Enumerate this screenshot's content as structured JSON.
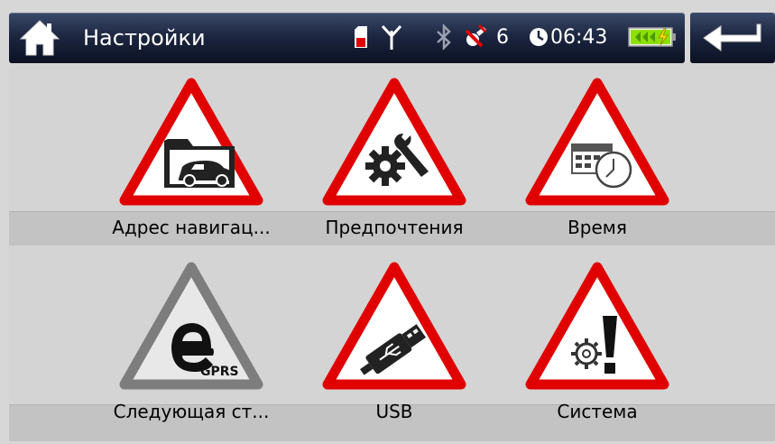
{
  "header": {
    "title": "Настройки",
    "satellites": "6",
    "time": "06:43"
  },
  "tiles": [
    {
      "label": "Адрес навигац...",
      "icon": "folder-car-icon"
    },
    {
      "label": "Предпочтения",
      "icon": "tools-gear-icon"
    },
    {
      "label": "Время",
      "icon": "calendar-clock-icon"
    },
    {
      "label": "Следующая ст...",
      "icon": "egprs-icon"
    },
    {
      "label": "USB",
      "icon": "usb-icon"
    },
    {
      "label": "Система",
      "icon": "system-warning-icon"
    }
  ],
  "colors": {
    "accent": "#e10000",
    "disabled": "#7d7d7d",
    "header_bg": "#1d2741",
    "battery": "#8de000"
  }
}
